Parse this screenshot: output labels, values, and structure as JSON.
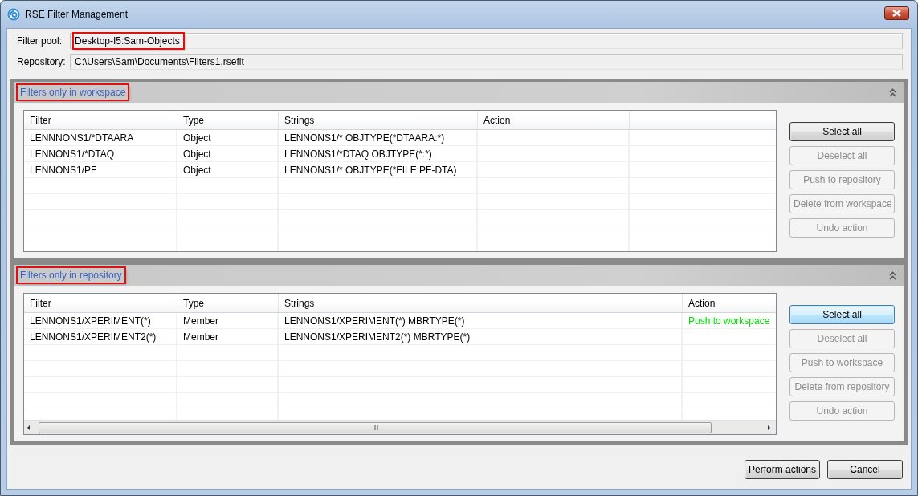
{
  "window": {
    "title": "RSE Filter Management"
  },
  "fields": [
    {
      "label": "Filter pool:",
      "value": "Desktop-I5:Sam-Objects",
      "highlighted": true
    },
    {
      "label": "Repository:",
      "value": "C:\\Users\\Sam\\Documents\\Filters1.rseflt",
      "highlighted": false
    }
  ],
  "sections": [
    {
      "title": "Filters only in workspace",
      "highlighted": true,
      "scrollbar": false,
      "columns": [
        "Filter",
        "Type",
        "Strings",
        "Action"
      ],
      "rows": [
        {
          "filter": "LENNNONS1/*DTAARA",
          "type": "Object",
          "strings": "LENNONS1/* OBJTYPE(*DTAARA:*)"
        },
        {
          "filter": "LENNONS1/*DTAQ",
          "type": "Object",
          "strings": "LENNONS1/*DTAQ OBJTYPE(*:*)"
        },
        {
          "filter": "LENNONS1/PF",
          "type": "Object",
          "strings": "LENNONS1/* OBJTYPE(*FILE:PF-DTA)"
        }
      ],
      "buttons": [
        {
          "label": "Select all",
          "disabled": false,
          "focused": false
        },
        {
          "label": "Deselect all",
          "disabled": true,
          "focused": false
        },
        {
          "label": "Push to repository",
          "disabled": true,
          "focused": false
        },
        {
          "label": "Delete from workspace",
          "disabled": true,
          "focused": false
        },
        {
          "label": "Undo action",
          "disabled": true,
          "focused": false
        }
      ]
    },
    {
      "title": "Filters only in repository",
      "highlighted": true,
      "scrollbar": true,
      "columns": [
        "Filter",
        "Type",
        "Strings",
        "Action"
      ],
      "rows": [
        {
          "filter": "LENNONS1/XPERIMENT(*)",
          "type": "Member",
          "strings": "LENNONS1/XPERIMENT(*) MBRTYPE(*)",
          "action": "Push to workspace"
        },
        {
          "filter": "LENNONS1/XPERIMENT2(*)",
          "type": "Member",
          "strings": "LENNONS1/XPERIMENT2(*) MBRTYPE(*)"
        }
      ],
      "buttons": [
        {
          "label": "Select all",
          "disabled": false,
          "focused": true
        },
        {
          "label": "Deselect all",
          "disabled": true,
          "focused": false
        },
        {
          "label": "Push to workspace",
          "disabled": true,
          "focused": false
        },
        {
          "label": "Delete from repository",
          "disabled": true,
          "focused": false
        },
        {
          "label": "Undo action",
          "disabled": true,
          "focused": false
        }
      ]
    }
  ],
  "footer_buttons": [
    "Perform actions",
    "Cancel"
  ]
}
